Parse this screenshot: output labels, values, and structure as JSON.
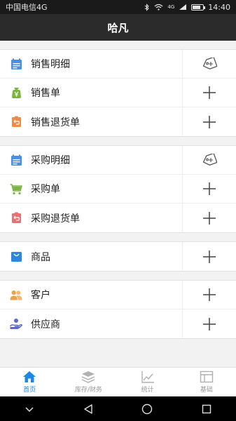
{
  "status_bar": {
    "carrier": "中国电信4G",
    "network_badge": "4G",
    "time": "14:40"
  },
  "header": {
    "title": "哈凡"
  },
  "groups": [
    {
      "items": [
        {
          "label": "销售明细",
          "icon": "calendar-icon",
          "icon_color": "#4a90e2",
          "action": "tag-icon"
        },
        {
          "label": "销售单",
          "icon": "yuan-bag-icon",
          "icon_color": "#7cb342",
          "action": "plus-icon"
        },
        {
          "label": "销售退货单",
          "icon": "return-icon",
          "icon_color": "#f08a4b",
          "action": "plus-icon"
        }
      ]
    },
    {
      "items": [
        {
          "label": "采购明细",
          "icon": "calendar-icon",
          "icon_color": "#4a90e2",
          "action": "tag-icon"
        },
        {
          "label": "采购单",
          "icon": "cart-icon",
          "icon_color": "#7cb342",
          "action": "plus-icon"
        },
        {
          "label": "采购退货单",
          "icon": "return-icon",
          "icon_color": "#e57373",
          "action": "plus-icon"
        }
      ]
    },
    {
      "items": [
        {
          "label": "商品",
          "icon": "shopping-bag-icon",
          "icon_color": "#2e86de",
          "action": "plus-icon"
        }
      ]
    },
    {
      "items": [
        {
          "label": "客户",
          "icon": "customers-icon",
          "icon_color": "#f0a04b",
          "action": "plus-icon"
        },
        {
          "label": "供应商",
          "icon": "supplier-icon",
          "icon_color": "#5c6bc0",
          "action": "plus-icon"
        }
      ]
    }
  ],
  "tabs": [
    {
      "label": "首页",
      "icon": "home-icon",
      "active": true
    },
    {
      "label": "库存/财务",
      "icon": "layers-icon",
      "active": false
    },
    {
      "label": "统计",
      "icon": "chart-icon",
      "active": false
    },
    {
      "label": "基础",
      "icon": "layout-icon",
      "active": false
    }
  ],
  "colors": {
    "accent": "#1e88e5",
    "header_bg": "#2b2b2b"
  }
}
